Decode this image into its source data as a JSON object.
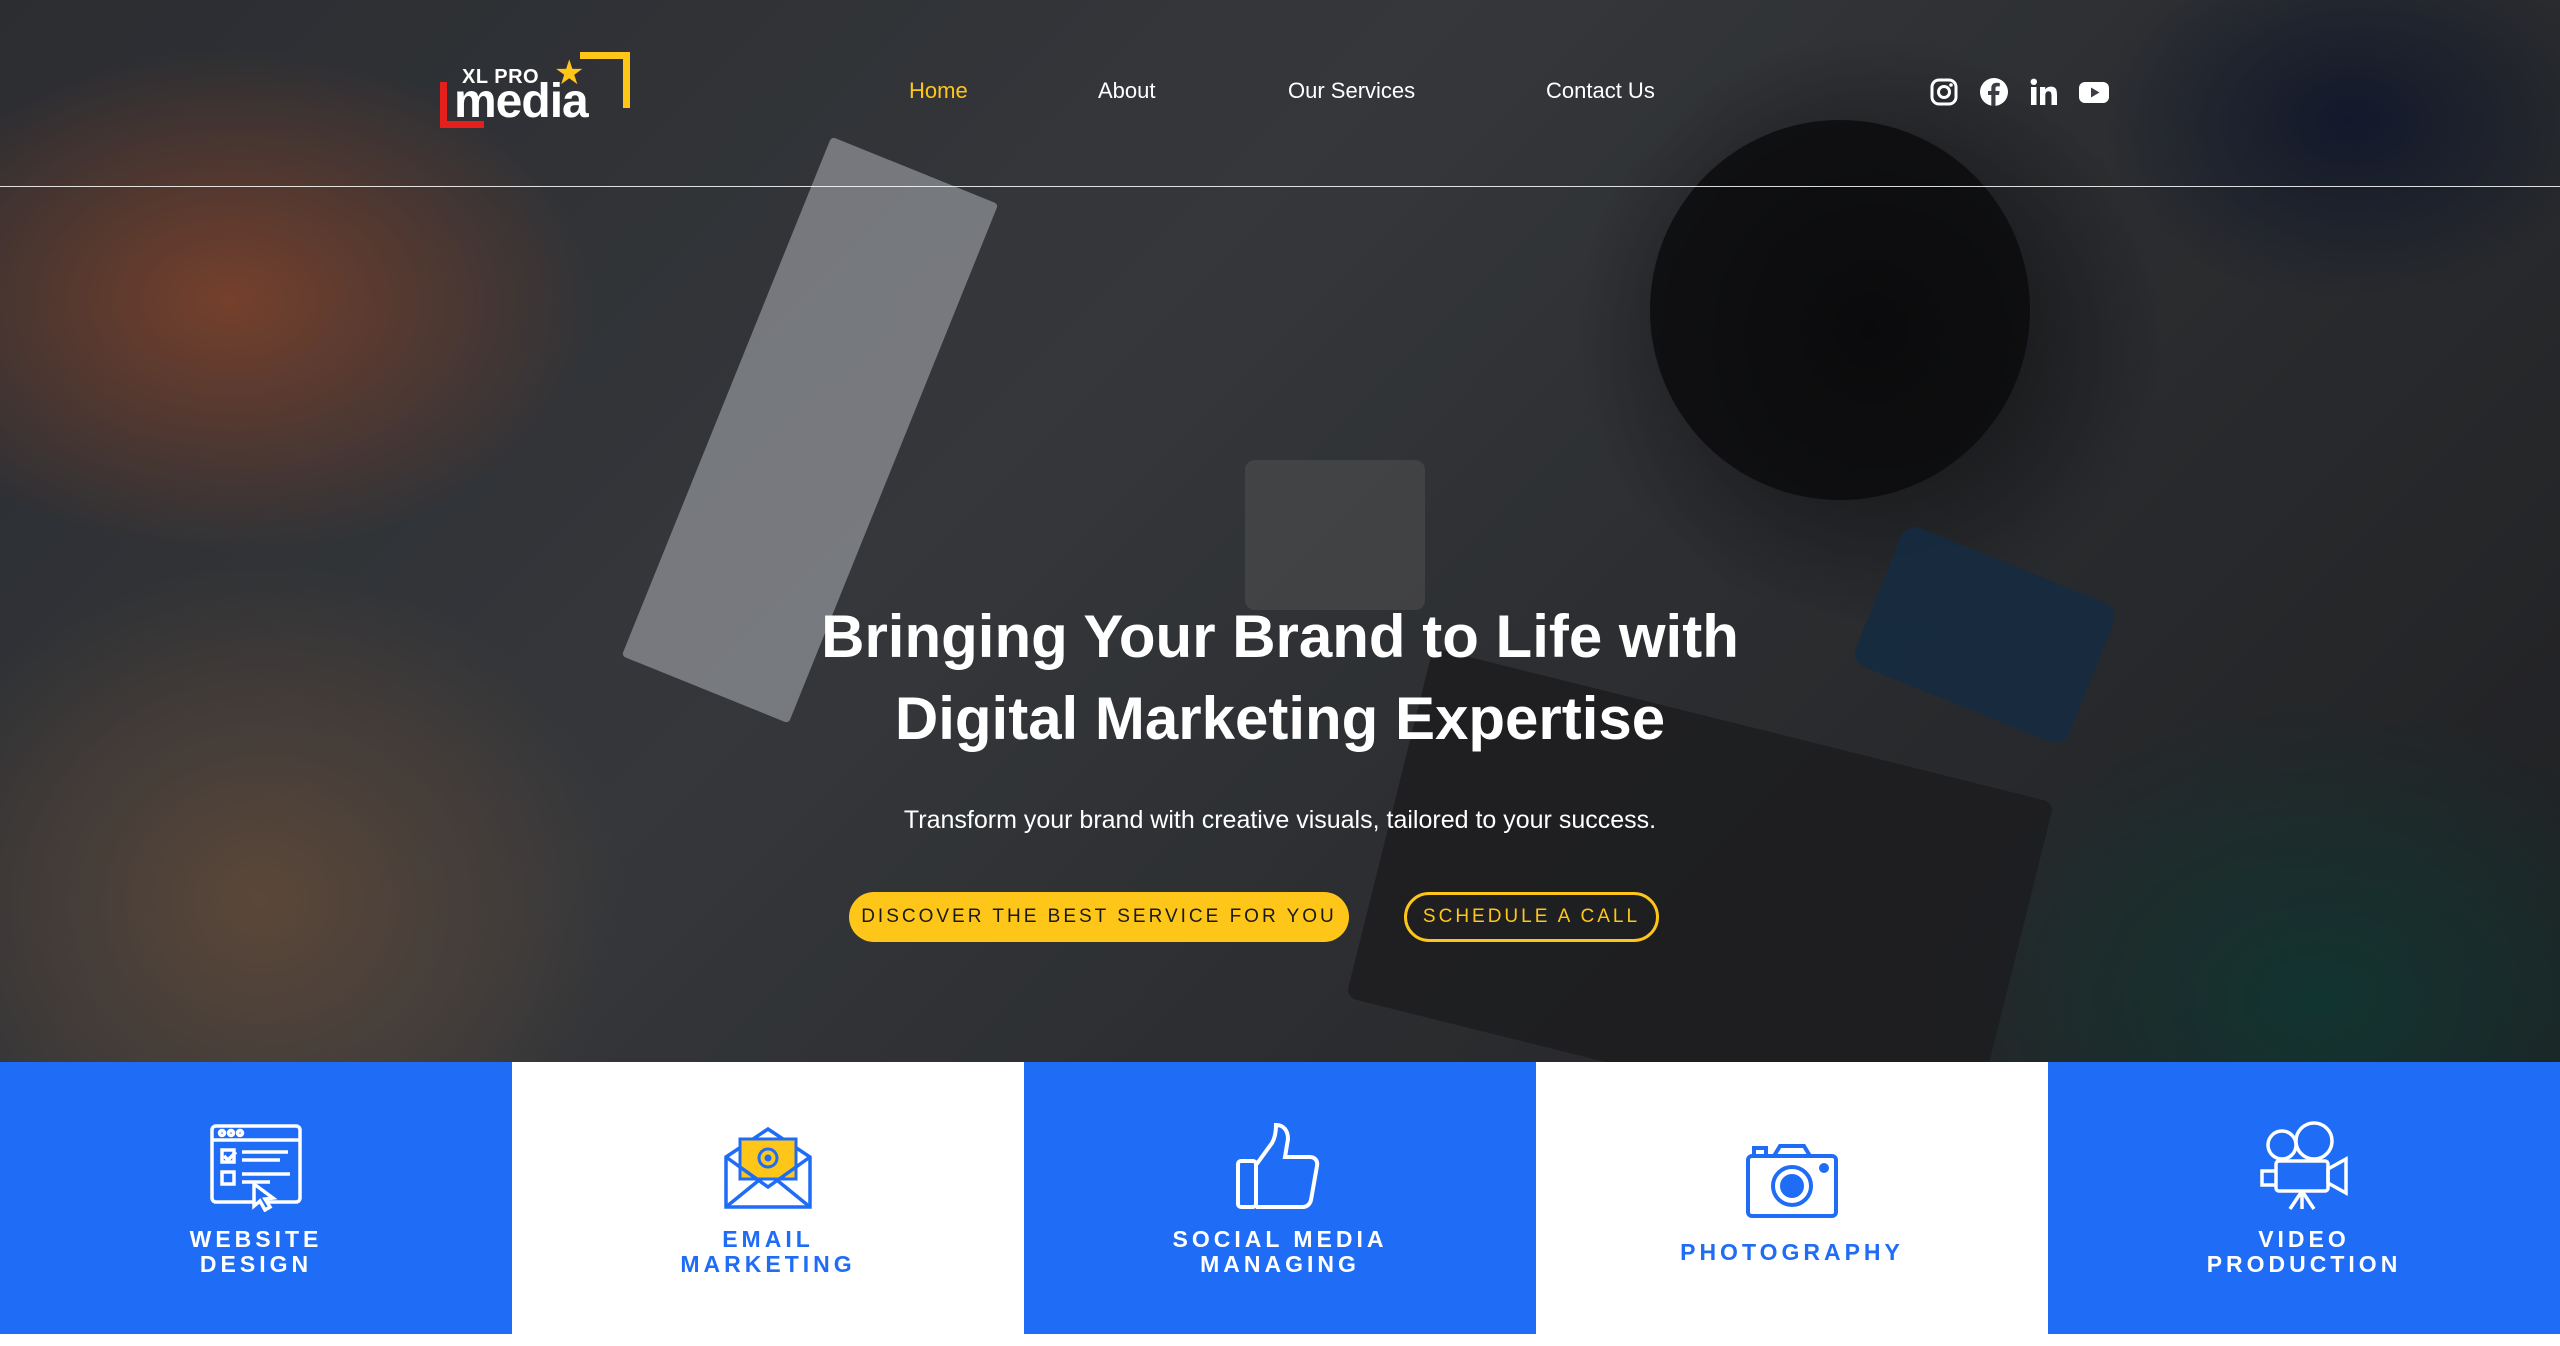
{
  "brand": {
    "logo_small": "XL PRO",
    "logo_large": "media"
  },
  "nav": {
    "items": [
      {
        "label": "Home",
        "active": true
      },
      {
        "label": "About",
        "active": false
      },
      {
        "label": "Our Services",
        "active": false
      },
      {
        "label": "Contact Us",
        "active": false
      }
    ]
  },
  "social": {
    "icons": [
      "instagram-icon",
      "facebook-icon",
      "linkedin-icon",
      "youtube-icon"
    ]
  },
  "hero": {
    "title_line1": "Bringing Your Brand to Life with",
    "title_line2": "Digital Marketing Expertise",
    "subtitle": "Transform your brand with creative visuals, tailored to your success.",
    "primary_button": "DISCOVER THE BEST SERVICE FOR YOU",
    "secondary_button": "SCHEDULE A CALL"
  },
  "services": [
    {
      "line1": "WEBSITE",
      "line2": "DESIGN",
      "icon": "website-design-icon"
    },
    {
      "line1": "EMAIL",
      "line2": "MARKETING",
      "icon": "email-icon"
    },
    {
      "line1": "SOCIAL MEDIA",
      "line2": "MANAGING",
      "icon": "thumbs-up-icon"
    },
    {
      "line1": "PHOTOGRAPHY",
      "line2": "",
      "icon": "camera-icon"
    },
    {
      "line1": "VIDEO",
      "line2": "PRODUCTION",
      "icon": "video-camera-icon"
    }
  ],
  "colors": {
    "accent_yellow": "#ffc61a",
    "brand_blue": "#1f6df6",
    "logo_red": "#e5201c"
  }
}
